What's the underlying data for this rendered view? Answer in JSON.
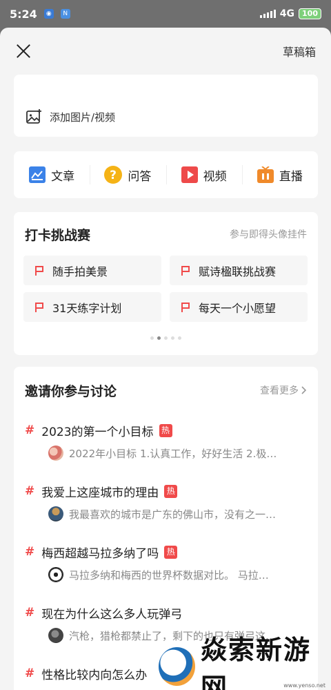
{
  "status": {
    "time": "5:24",
    "network": "4G",
    "battery": "100"
  },
  "header": {
    "drafts": "草稿箱"
  },
  "media": {
    "add_label": "添加图片/视频"
  },
  "types": [
    {
      "label": "文章",
      "icon": "article-icon",
      "color": "#3b82e8"
    },
    {
      "label": "问答",
      "icon": "question-icon",
      "color": "#f5b316"
    },
    {
      "label": "视频",
      "icon": "video-icon",
      "color": "#ee4a4a"
    },
    {
      "label": "直播",
      "icon": "live-icon",
      "color": "#f08a2a"
    }
  ],
  "challenge": {
    "title": "打卡挑战赛",
    "more": "参与即得头像挂件",
    "items": [
      "随手拍美景",
      "赋诗楹联挑战赛",
      "31天练字计划",
      "每天一个小愿望"
    ]
  },
  "discuss": {
    "title": "邀请你参与讨论",
    "more": "查看更多",
    "hot_label": "热",
    "topics": [
      {
        "title": "2023的第一个小目标",
        "hot": true,
        "sub": "2022年小目标 1.认真工作，好好生活 2.极…"
      },
      {
        "title": "我爱上这座城市的理由",
        "hot": true,
        "sub": "我最喜欢的城市是广东的佛山市，没有之一…"
      },
      {
        "title": "梅西超越马拉多纳了吗",
        "hot": true,
        "sub": "马拉多纳和梅西的世界杯数据对比。 马拉…"
      },
      {
        "title": "现在为什么这么多人玩弹弓",
        "hot": false,
        "sub": "汽枪，猎枪都禁止了，剩下的也只有弹弓这…"
      },
      {
        "title": "性格比较内向怎么办",
        "hot": false,
        "sub": ""
      }
    ]
  },
  "watermark": {
    "text": "焱索新游网",
    "url": "www.yenso.net"
  }
}
